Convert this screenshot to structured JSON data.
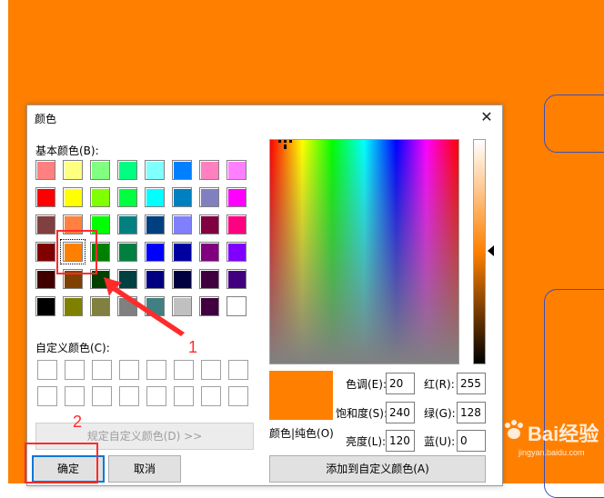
{
  "dialog": {
    "title": "颜色",
    "close_glyph": "✕",
    "basic_colors_label": "基本颜色(B):",
    "custom_colors_label": "自定义颜色(C):",
    "define_custom_button": "规定自定义颜色(D) >>",
    "ok_button": "确定",
    "cancel_button": "取消",
    "add_custom_button": "添加到自定义颜色(A)",
    "color_solid_label": "颜色|纯色(O)",
    "fields": {
      "hue": {
        "label": "色调(E):",
        "value": "20"
      },
      "sat": {
        "label": "饱和度(S):",
        "value": "240"
      },
      "lum": {
        "label": "亮度(L):",
        "value": "120"
      },
      "red": {
        "label": "红(R):",
        "value": "255"
      },
      "green": {
        "label": "绿(G):",
        "value": "128"
      },
      "blue": {
        "label": "蓝(U):",
        "value": "0"
      }
    }
  },
  "basic_colors": [
    "#ff8080",
    "#ffff80",
    "#80ff80",
    "#00ff80",
    "#80ffff",
    "#0080ff",
    "#ff80c0",
    "#ff80ff",
    "#ff0000",
    "#ffff00",
    "#80ff00",
    "#00ff40",
    "#00ffff",
    "#0080c0",
    "#8080c0",
    "#ff00ff",
    "#804040",
    "#ff8040",
    "#00ff00",
    "#008080",
    "#004080",
    "#8080ff",
    "#800040",
    "#ff0080",
    "#800000",
    "#ff8000",
    "#008000",
    "#008040",
    "#0000ff",
    "#0000a0",
    "#800080",
    "#8000ff",
    "#400000",
    "#804000",
    "#004000",
    "#004040",
    "#000080",
    "#000040",
    "#400040",
    "#400080",
    "#000000",
    "#808000",
    "#808040",
    "#808080",
    "#408080",
    "#c0c0c0",
    "#400040",
    "#ffffff"
  ],
  "selected_color_index": 25,
  "accent": "#ff8000",
  "annotation": {
    "label_1": "1",
    "label_2": "2",
    "color": "#ff2b2b"
  },
  "watermark": {
    "text": "Bai经验",
    "sub": "jingyan.baidu.com"
  }
}
